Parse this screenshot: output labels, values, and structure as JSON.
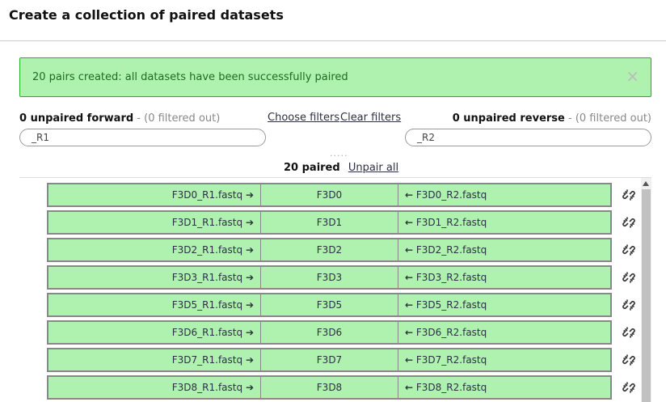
{
  "header": {
    "title": "Create a collection of paired datasets"
  },
  "alert": {
    "message": "20 pairs created: all datasets have been successfully paired",
    "close_symbol": "×"
  },
  "forward": {
    "count_label": "0 unpaired forward",
    "filtered": " - (0 filtered out)",
    "filter_value": "_R1"
  },
  "reverse": {
    "count_label": "0 unpaired reverse",
    "filtered": " - (0 filtered out)",
    "filter_value": "_R2"
  },
  "filters": {
    "choose_label": "Choose filters",
    "clear_label": "Clear filters"
  },
  "divider": {
    "dots": "....."
  },
  "paired": {
    "count_label": "20 paired",
    "unpair_all_label": "Unpair all"
  },
  "pairs": [
    {
      "forward": "F3D0_R1.fastq",
      "name": "F3D0",
      "reverse": "F3D0_R2.fastq"
    },
    {
      "forward": "F3D1_R1.fastq",
      "name": "F3D1",
      "reverse": "F3D1_R2.fastq"
    },
    {
      "forward": "F3D2_R1.fastq",
      "name": "F3D2",
      "reverse": "F3D2_R2.fastq"
    },
    {
      "forward": "F3D3_R1.fastq",
      "name": "F3D3",
      "reverse": "F3D3_R2.fastq"
    },
    {
      "forward": "F3D5_R1.fastq",
      "name": "F3D5",
      "reverse": "F3D5_R2.fastq"
    },
    {
      "forward": "F3D6_R1.fastq",
      "name": "F3D6",
      "reverse": "F3D6_R2.fastq"
    },
    {
      "forward": "F3D7_R1.fastq",
      "name": "F3D7",
      "reverse": "F3D7_R2.fastq"
    },
    {
      "forward": "F3D8_R1.fastq",
      "name": "F3D8",
      "reverse": "F3D8_R2.fastq"
    }
  ],
  "icons": {
    "forward_arrow": "arrow-right-icon",
    "reverse_arrow": "arrow-left-icon",
    "unpair": "unlink-icon"
  },
  "colors": {
    "pair_bg": "#aff1af",
    "alert_bg": "#aff1af",
    "alert_border": "#20b420",
    "alert_text": "#1e6d1e"
  }
}
